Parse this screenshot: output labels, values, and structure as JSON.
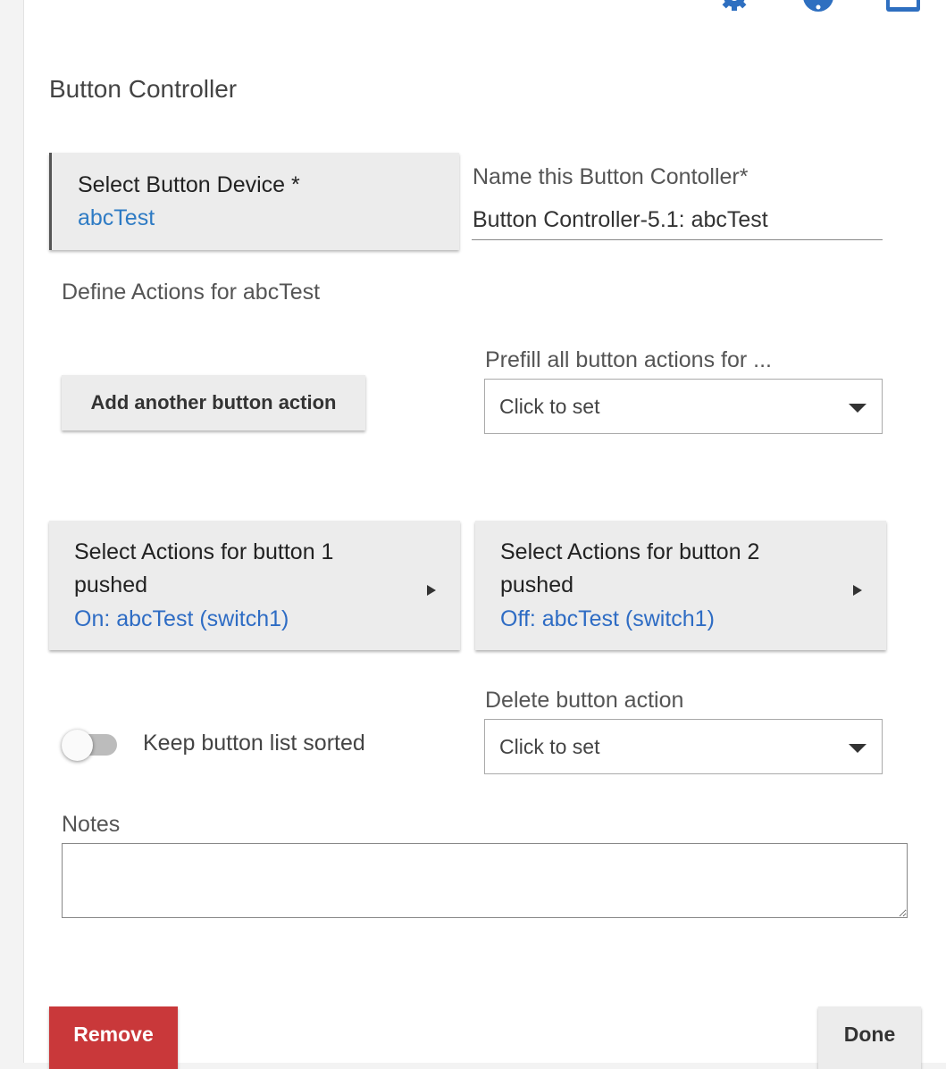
{
  "header": {
    "icons": [
      "gear-icon",
      "help-icon",
      "window-icon"
    ],
    "accent_color": "#2e7bc4"
  },
  "page": {
    "title": "Button Controller"
  },
  "device_select": {
    "label": "Select Button Device *",
    "value": "abcTest"
  },
  "name_field": {
    "label": "Name this Button Contoller*",
    "value": "Button Controller-5.1: abcTest"
  },
  "define_actions_label": "Define Actions for abcTest",
  "add_action_button": "Add another button action",
  "prefill": {
    "label": "Prefill all button actions for ...",
    "value": "Click to set"
  },
  "button_actions": [
    {
      "line1": "Select Actions for button 1",
      "line2": "pushed",
      "action": "On: abcTest (switch1)"
    },
    {
      "line1": "Select Actions for button 2",
      "line2": "pushed",
      "action": "Off: abcTest (switch1)"
    }
  ],
  "sort_toggle": {
    "label": "Keep button list sorted",
    "on": false
  },
  "delete_action": {
    "label": "Delete button action",
    "value": "Click to set"
  },
  "notes": {
    "label": "Notes",
    "value": ""
  },
  "footer": {
    "remove_label": "Remove",
    "done_label": "Done",
    "remove_color": "#c9383a"
  }
}
